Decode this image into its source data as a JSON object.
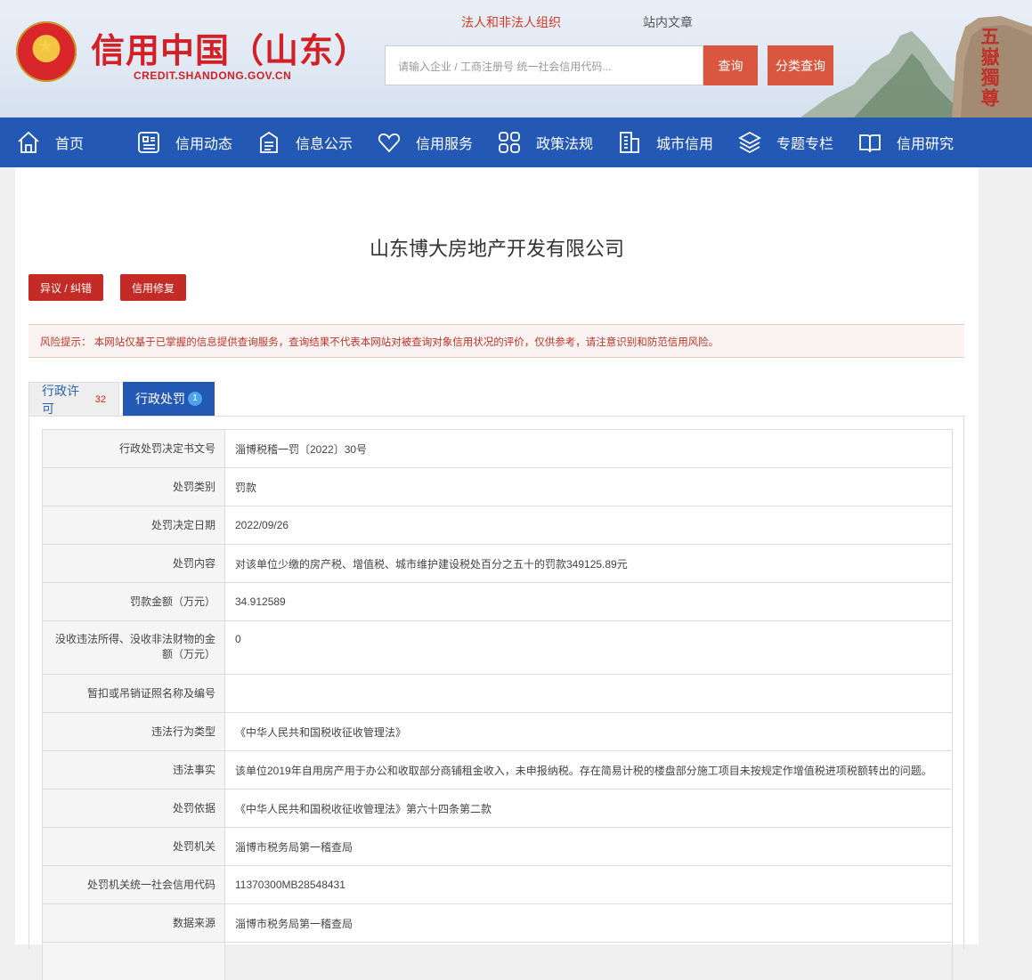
{
  "header": {
    "site_title": "信用中国（山东）",
    "site_domain": "CREDIT.SHANDONG.GOV.CN",
    "top_links": [
      "法人和非法人组织",
      "站内文章"
    ],
    "search_placeholder": "请输入企业 / 工商注册号 统一社会信用代码...",
    "search_button": "查询",
    "category_button": "分类查询",
    "rock_inscription": "五嶽獨尊"
  },
  "nav": [
    {
      "label": "首页",
      "icon": "home-icon"
    },
    {
      "label": "信用动态",
      "icon": "news-icon"
    },
    {
      "label": "信息公示",
      "icon": "document-icon"
    },
    {
      "label": "信用服务",
      "icon": "heart-icon"
    },
    {
      "label": "政策法规",
      "icon": "grid-icon"
    },
    {
      "label": "城市信用",
      "icon": "building-icon"
    },
    {
      "label": "专题专栏",
      "icon": "layers-icon"
    },
    {
      "label": "信用研究",
      "icon": "book-icon"
    }
  ],
  "company": {
    "name": "山东博大房地产开发有限公司",
    "objection_button": "异议 / 纠错",
    "repair_button": "信用修复"
  },
  "risk_notice": "风险提示：  本网站仅基于已掌握的信息提供查询服务，查询结果不代表本网站对被查询对象信用状况的评价，仅供参考，请注意识别和防范信用风险。",
  "tabs": {
    "license": {
      "label": "行政许可",
      "count": "32"
    },
    "penalty": {
      "label": "行政处罚",
      "count": "1"
    }
  },
  "penalty_rows": [
    {
      "label": "行政处罚决定书文号",
      "value": "淄博税稽一罚〔2022〕30号"
    },
    {
      "label": "处罚类别",
      "value": "罚款"
    },
    {
      "label": "处罚决定日期",
      "value": "2022/09/26"
    },
    {
      "label": "处罚内容",
      "value": "对该单位少缴的房产税、增值税、城市维护建设税处百分之五十的罚款349125.89元"
    },
    {
      "label": "罚款金额（万元）",
      "value": "34.912589"
    },
    {
      "label": "没收违法所得、没收非法财物的金额（万元）",
      "value": "0"
    },
    {
      "label": "暂扣或吊销证照名称及编号",
      "value": ""
    },
    {
      "label": "违法行为类型",
      "value": "《中华人民共和国税收征收管理法》"
    },
    {
      "label": "违法事实",
      "value": "该单位2019年自用房产用于办公和收取部分商铺租金收入，未申报纳税。存在简易计税的楼盘部分施工项目未按规定作增值税进项税额转出的问题。"
    },
    {
      "label": "处罚依据",
      "value": "《中华人民共和国税收征收管理法》第六十四条第二款"
    },
    {
      "label": "处罚机关",
      "value": "淄博市税务局第一稽查局"
    },
    {
      "label": "处罚机关统一社会信用代码",
      "value": "11370300MB28548431"
    },
    {
      "label": "数据来源",
      "value": "淄博市税务局第一稽查局"
    }
  ]
}
